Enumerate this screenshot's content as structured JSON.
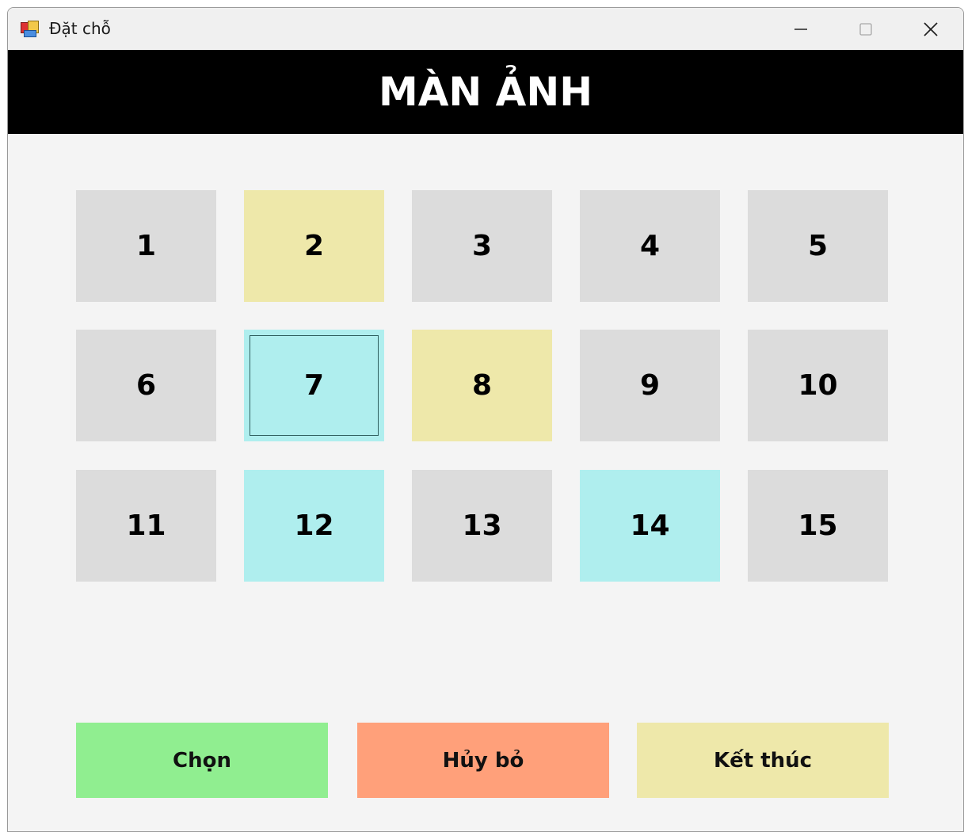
{
  "window": {
    "title": "Đặt chỗ"
  },
  "screen": {
    "label": "MÀN ẢNH"
  },
  "seats": [
    {
      "label": "1",
      "status": "available",
      "color": "#dcdcdc"
    },
    {
      "label": "2",
      "status": "booked",
      "color": "#eee8aa"
    },
    {
      "label": "3",
      "status": "available",
      "color": "#dcdcdc"
    },
    {
      "label": "4",
      "status": "available",
      "color": "#dcdcdc"
    },
    {
      "label": "5",
      "status": "available",
      "color": "#dcdcdc"
    },
    {
      "label": "6",
      "status": "available",
      "color": "#dcdcdc"
    },
    {
      "label": "7",
      "status": "selected",
      "color": "#afeeee",
      "focused": true
    },
    {
      "label": "8",
      "status": "booked",
      "color": "#eee8aa"
    },
    {
      "label": "9",
      "status": "available",
      "color": "#dcdcdc"
    },
    {
      "label": "10",
      "status": "available",
      "color": "#dcdcdc"
    },
    {
      "label": "11",
      "status": "available",
      "color": "#dcdcdc"
    },
    {
      "label": "12",
      "status": "selected",
      "color": "#afeeee"
    },
    {
      "label": "13",
      "status": "available",
      "color": "#dcdcdc"
    },
    {
      "label": "14",
      "status": "selected",
      "color": "#afeeee"
    },
    {
      "label": "15",
      "status": "available",
      "color": "#dcdcdc"
    }
  ],
  "actions": {
    "choose": {
      "label": "Chọn",
      "color": "#90ee90"
    },
    "cancel": {
      "label": "Hủy bỏ",
      "color": "#ffa07a"
    },
    "finish": {
      "label": "Kết thúc",
      "color": "#eee8aa"
    }
  }
}
